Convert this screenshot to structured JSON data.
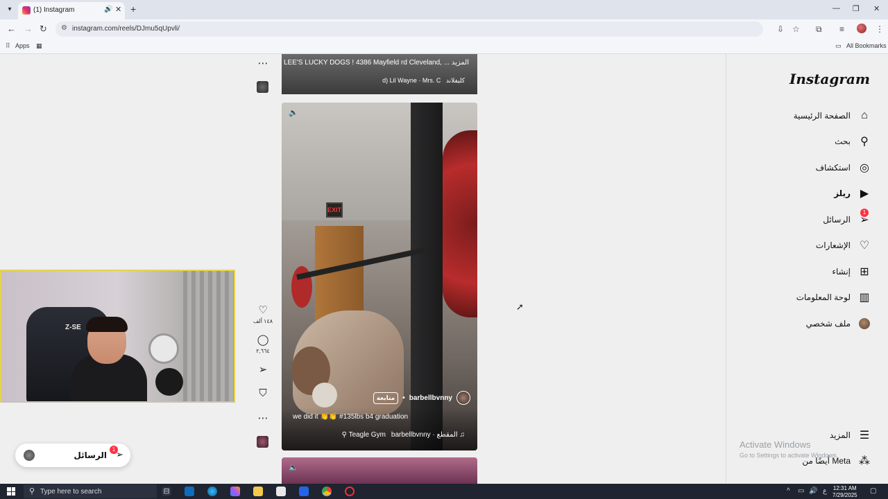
{
  "browser": {
    "tab_title": "(1) Instagram",
    "url": "instagram.com/reels/DJmu5qUpvli/",
    "bookmarks": {
      "apps": "Apps",
      "all_bookmarks": "All Bookmarks"
    }
  },
  "sidebar": {
    "logo": "Instagram",
    "items": [
      {
        "label": "الصفحة الرئيسية",
        "icon": "home-icon"
      },
      {
        "label": "بحث",
        "icon": "search-icon"
      },
      {
        "label": "استكشاف",
        "icon": "compass-icon"
      },
      {
        "label": "ريلز",
        "icon": "reels-icon"
      },
      {
        "label": "الرسائل",
        "icon": "messages-icon",
        "badge": "1"
      },
      {
        "label": "الإشعارات",
        "icon": "heart-icon"
      },
      {
        "label": "إنشاء",
        "icon": "create-icon"
      },
      {
        "label": "لوحة المعلومات",
        "icon": "dashboard-icon"
      },
      {
        "label": "ملف شخصي",
        "icon": "profile-avatar"
      }
    ],
    "more": "المزيد",
    "meta": "أيضًا من Meta"
  },
  "watermark": {
    "line1": "Activate Windows",
    "line2": "Go to Settings to activate Windows."
  },
  "reel_top": {
    "caption": "LEE'S LUCKY DOGS ! 4386 Mayfield rd Cleveland, ... المزيد",
    "location": "كليفلاند",
    "audio": "d)  Lil Wayne · Mrs. C"
  },
  "reel_main": {
    "username": "barbellbvnny",
    "follow": "متابعة",
    "caption": "we did it 👏👏 #135lbs b4 graduation",
    "audio": "barbellbvnny · المقطع",
    "location": "Teagle Gym",
    "exit_sign": "EXIT",
    "likes": "١٤٨ ألف",
    "comments": "٢,٦٦٤"
  },
  "messages_pill": {
    "label": "الرسائل",
    "badge": "1"
  },
  "webcam": {
    "chair_text": "Z-SE"
  },
  "taskbar": {
    "search_placeholder": "Type here to search",
    "time": "12:31 AM",
    "date": "7/29/2025",
    "lang": "ع"
  }
}
